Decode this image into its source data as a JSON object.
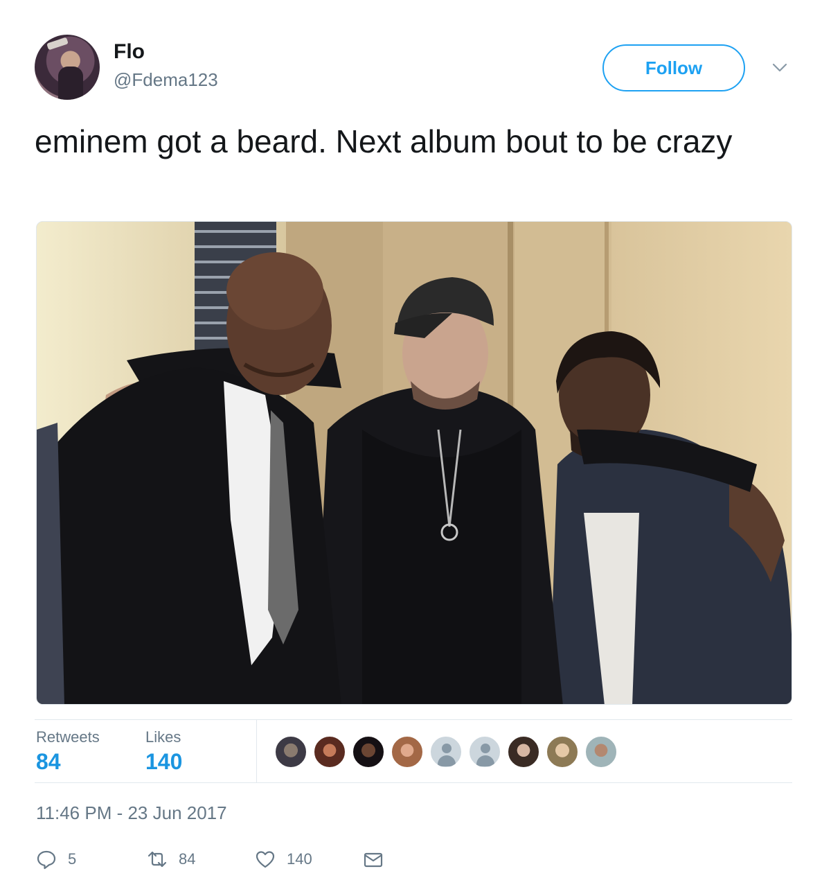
{
  "header": {
    "name": "Flo",
    "handle": "@Fdema123",
    "follow_label": "Follow"
  },
  "tweet": {
    "text": "eminem got a beard. Next album bout to be crazy"
  },
  "stats": {
    "retweets_label": "Retweets",
    "retweets_count": "84",
    "likes_label": "Likes",
    "likes_count": "140"
  },
  "timestamp": "11:46 PM - 23 Jun 2017",
  "actions": {
    "reply_count": "5",
    "retweet_count": "84",
    "like_count": "140"
  },
  "colors": {
    "accent": "#1da1f2",
    "link": "#1b95e0",
    "muted": "#657786",
    "border": "#e1e8ed"
  },
  "icons": [
    "chevron-down-icon",
    "reply-icon",
    "retweet-icon",
    "heart-icon",
    "dm-envelope-icon"
  ]
}
